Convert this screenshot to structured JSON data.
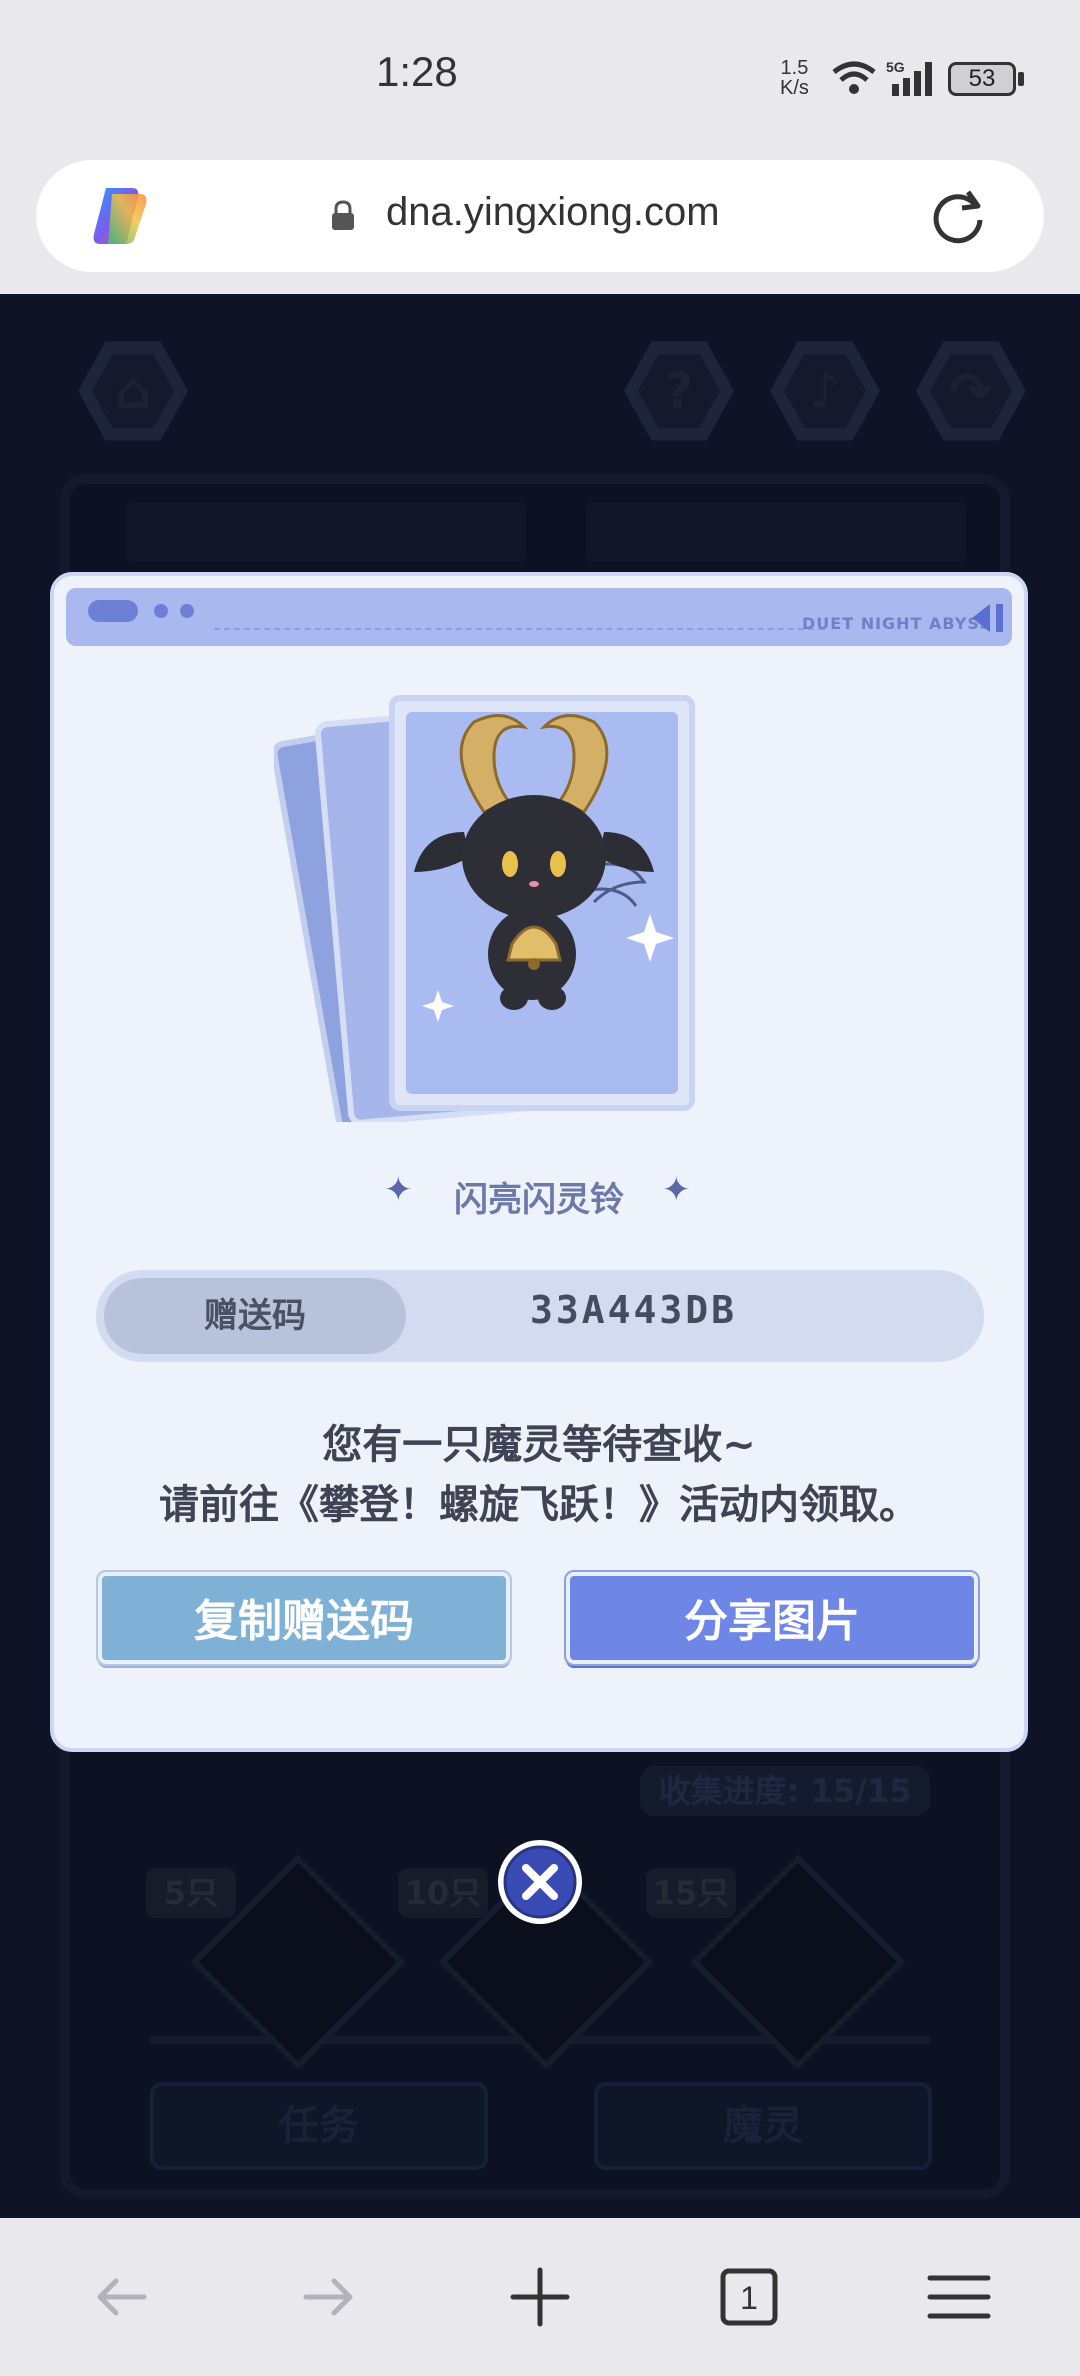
{
  "status_bar": {
    "time": "1:28",
    "net_speed_value": "1.5",
    "net_speed_unit": "K/s",
    "network_type": "5G",
    "battery": "53"
  },
  "browser": {
    "url": "dna.yingxiong.com",
    "tab_count": "1"
  },
  "game_background": {
    "collection_progress": "收集进度: 15/15",
    "tiers": [
      "5只",
      "10只",
      "15只"
    ],
    "bottom_tabs": [
      "任务",
      "魔灵"
    ]
  },
  "modal": {
    "brand": "DUET NIGHT ABYSS",
    "item_name": "闪亮闪灵铃",
    "gift_code_label": "赠送码",
    "gift_code_value": "33A443DB",
    "message_line1": "您有一只魔灵等待查收~",
    "message_line2": "请前往《攀登！螺旋飞跃！》活动内领取。",
    "copy_button": "复制赠送码",
    "share_button": "分享图片"
  },
  "colors": {
    "modal_header": "#a9b8ef",
    "copy_button": "#7fb1d6",
    "share_button": "#6e86e6",
    "close_button": "#3b4bb5"
  },
  "icons": {
    "top_left": "home-icon",
    "top_right": [
      "help-icon",
      "music-icon",
      "share-icon"
    ],
    "nav": [
      "back-arrow-icon",
      "forward-arrow-icon",
      "new-tab-icon",
      "tabs-icon",
      "menu-icon"
    ]
  }
}
